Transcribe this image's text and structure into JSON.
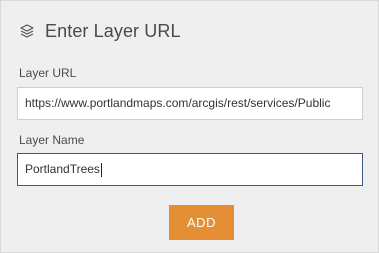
{
  "header": {
    "icon": "layers-icon",
    "title": "Enter Layer URL"
  },
  "form": {
    "url_label": "Layer URL",
    "url_value": "https://www.portlandmaps.com/arcgis/rest/services/Public",
    "name_label": "Layer Name",
    "name_value": "PortlandTrees"
  },
  "actions": {
    "add_label": "ADD"
  },
  "colors": {
    "panel_bg": "#efefef",
    "accent_button": "#e48f35",
    "focus_border": "#3c5a86"
  }
}
